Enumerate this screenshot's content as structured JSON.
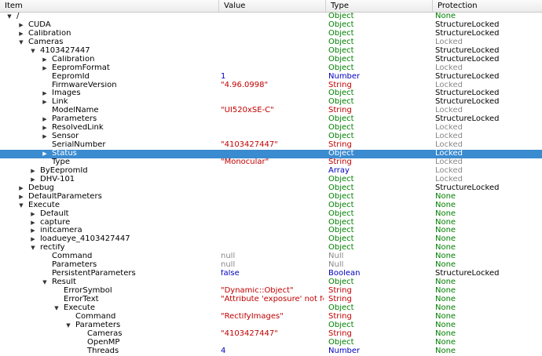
{
  "header": {
    "item": "Item",
    "value": "Value",
    "type": "Type",
    "protection": "Protection"
  },
  "rows": [
    {
      "label": "/",
      "depth": 0,
      "exp": "down",
      "value": "",
      "vcolor": "",
      "type": "Object",
      "tcolor": "green",
      "prot": "None",
      "pcolor": "green"
    },
    {
      "label": "CUDA",
      "depth": 1,
      "exp": "right",
      "value": "",
      "vcolor": "",
      "type": "Object",
      "tcolor": "green",
      "prot": "StructureLocked",
      "pcolor": "black"
    },
    {
      "label": "Calibration",
      "depth": 1,
      "exp": "right",
      "value": "",
      "vcolor": "",
      "type": "Object",
      "tcolor": "green",
      "prot": "StructureLocked",
      "pcolor": "black"
    },
    {
      "label": "Cameras",
      "depth": 1,
      "exp": "down",
      "value": "",
      "vcolor": "",
      "type": "Object",
      "tcolor": "green",
      "prot": "Locked",
      "pcolor": "gray"
    },
    {
      "label": "4103427447",
      "depth": 2,
      "exp": "down",
      "value": "",
      "vcolor": "",
      "type": "Object",
      "tcolor": "green",
      "prot": "StructureLocked",
      "pcolor": "black"
    },
    {
      "label": "Calibration",
      "depth": 3,
      "exp": "right",
      "value": "",
      "vcolor": "",
      "type": "Object",
      "tcolor": "green",
      "prot": "StructureLocked",
      "pcolor": "black"
    },
    {
      "label": "EepromFormat",
      "depth": 3,
      "exp": "right",
      "value": "",
      "vcolor": "",
      "type": "Object",
      "tcolor": "green",
      "prot": "Locked",
      "pcolor": "gray"
    },
    {
      "label": "EepromId",
      "depth": 3,
      "exp": "",
      "value": "1",
      "vcolor": "blue",
      "type": "Number",
      "tcolor": "blue",
      "prot": "StructureLocked",
      "pcolor": "black"
    },
    {
      "label": "FirmwareVersion",
      "depth": 3,
      "exp": "",
      "value": "\"4.96.0998\"",
      "vcolor": "red",
      "type": "String",
      "tcolor": "red",
      "prot": "Locked",
      "pcolor": "gray"
    },
    {
      "label": "Images",
      "depth": 3,
      "exp": "right",
      "value": "",
      "vcolor": "",
      "type": "Object",
      "tcolor": "green",
      "prot": "StructureLocked",
      "pcolor": "black"
    },
    {
      "label": "Link",
      "depth": 3,
      "exp": "right",
      "value": "",
      "vcolor": "",
      "type": "Object",
      "tcolor": "green",
      "prot": "StructureLocked",
      "pcolor": "black"
    },
    {
      "label": "ModelName",
      "depth": 3,
      "exp": "",
      "value": "\"UI520xSE-C\"",
      "vcolor": "red",
      "type": "String",
      "tcolor": "red",
      "prot": "Locked",
      "pcolor": "gray"
    },
    {
      "label": "Parameters",
      "depth": 3,
      "exp": "right",
      "value": "",
      "vcolor": "",
      "type": "Object",
      "tcolor": "green",
      "prot": "StructureLocked",
      "pcolor": "black"
    },
    {
      "label": "ResolvedLink",
      "depth": 3,
      "exp": "right",
      "value": "",
      "vcolor": "",
      "type": "Object",
      "tcolor": "green",
      "prot": "Locked",
      "pcolor": "gray"
    },
    {
      "label": "Sensor",
      "depth": 3,
      "exp": "right",
      "value": "",
      "vcolor": "",
      "type": "Object",
      "tcolor": "green",
      "prot": "Locked",
      "pcolor": "gray"
    },
    {
      "label": "SerialNumber",
      "depth": 3,
      "exp": "",
      "value": "\"4103427447\"",
      "vcolor": "red",
      "type": "String",
      "tcolor": "red",
      "prot": "Locked",
      "pcolor": "gray"
    },
    {
      "label": "Status",
      "depth": 3,
      "exp": "right",
      "value": "",
      "vcolor": "",
      "type": "Object",
      "tcolor": "green",
      "prot": "Locked",
      "pcolor": "gray",
      "selected": true
    },
    {
      "label": "Type",
      "depth": 3,
      "exp": "",
      "value": "\"Monocular\"",
      "vcolor": "red",
      "type": "String",
      "tcolor": "red",
      "prot": "Locked",
      "pcolor": "gray"
    },
    {
      "label": "ByEepromId",
      "depth": 2,
      "exp": "right",
      "value": "",
      "vcolor": "",
      "type": "Array",
      "tcolor": "blue",
      "prot": "Locked",
      "pcolor": "gray"
    },
    {
      "label": "DHV-101",
      "depth": 2,
      "exp": "right",
      "value": "",
      "vcolor": "",
      "type": "Object",
      "tcolor": "green",
      "prot": "Locked",
      "pcolor": "gray"
    },
    {
      "label": "Debug",
      "depth": 1,
      "exp": "right",
      "value": "",
      "vcolor": "",
      "type": "Object",
      "tcolor": "green",
      "prot": "StructureLocked",
      "pcolor": "black"
    },
    {
      "label": "DefaultParameters",
      "depth": 1,
      "exp": "right",
      "value": "",
      "vcolor": "",
      "type": "Object",
      "tcolor": "green",
      "prot": "None",
      "pcolor": "green"
    },
    {
      "label": "Execute",
      "depth": 1,
      "exp": "down",
      "value": "",
      "vcolor": "",
      "type": "Object",
      "tcolor": "green",
      "prot": "None",
      "pcolor": "green"
    },
    {
      "label": "Default",
      "depth": 2,
      "exp": "right",
      "value": "",
      "vcolor": "",
      "type": "Object",
      "tcolor": "green",
      "prot": "None",
      "pcolor": "green"
    },
    {
      "label": "capture",
      "depth": 2,
      "exp": "right",
      "value": "",
      "vcolor": "",
      "type": "Object",
      "tcolor": "green",
      "prot": "None",
      "pcolor": "green"
    },
    {
      "label": "initcamera",
      "depth": 2,
      "exp": "right",
      "value": "",
      "vcolor": "",
      "type": "Object",
      "tcolor": "green",
      "prot": "None",
      "pcolor": "green"
    },
    {
      "label": "loadueye_4103427447",
      "depth": 2,
      "exp": "right",
      "value": "",
      "vcolor": "",
      "type": "Object",
      "tcolor": "green",
      "prot": "None",
      "pcolor": "green"
    },
    {
      "label": "rectify",
      "depth": 2,
      "exp": "down",
      "value": "",
      "vcolor": "",
      "type": "Object",
      "tcolor": "green",
      "prot": "None",
      "pcolor": "green"
    },
    {
      "label": "Command",
      "depth": 3,
      "exp": "",
      "value": "null",
      "vcolor": "gray",
      "type": "Null",
      "tcolor": "gray",
      "prot": "None",
      "pcolor": "green"
    },
    {
      "label": "Parameters",
      "depth": 3,
      "exp": "",
      "value": "null",
      "vcolor": "gray",
      "type": "Null",
      "tcolor": "gray",
      "prot": "None",
      "pcolor": "green"
    },
    {
      "label": "PersistentParameters",
      "depth": 3,
      "exp": "",
      "value": "false",
      "vcolor": "blue",
      "type": "Boolean",
      "tcolor": "blue",
      "prot": "StructureLocked",
      "pcolor": "black"
    },
    {
      "label": "Result",
      "depth": 3,
      "exp": "down",
      "value": "",
      "vcolor": "",
      "type": "Object",
      "tcolor": "green",
      "prot": "None",
      "pcolor": "green"
    },
    {
      "label": "ErrorSymbol",
      "depth": 4,
      "exp": "",
      "value": "\"Dynamic::Object\"",
      "vcolor": "red",
      "type": "String",
      "tcolor": "red",
      "prot": "None",
      "pcolor": "green"
    },
    {
      "label": "ErrorText",
      "depth": 4,
      "exp": "",
      "value": "\"Attribute 'exposure' not fo...",
      "vcolor": "red",
      "type": "String",
      "tcolor": "red",
      "prot": "None",
      "pcolor": "green"
    },
    {
      "label": "Execute",
      "depth": 4,
      "exp": "down",
      "value": "",
      "vcolor": "",
      "type": "Object",
      "tcolor": "green",
      "prot": "None",
      "pcolor": "green"
    },
    {
      "label": "Command",
      "depth": 5,
      "exp": "",
      "value": "\"RectifyImages\"",
      "vcolor": "red",
      "type": "String",
      "tcolor": "red",
      "prot": "None",
      "pcolor": "green"
    },
    {
      "label": "Parameters",
      "depth": 5,
      "exp": "down",
      "value": "",
      "vcolor": "",
      "type": "Object",
      "tcolor": "green",
      "prot": "None",
      "pcolor": "green"
    },
    {
      "label": "Cameras",
      "depth": 6,
      "exp": "",
      "value": "\"4103427447\"",
      "vcolor": "red",
      "type": "String",
      "tcolor": "red",
      "prot": "None",
      "pcolor": "green"
    },
    {
      "label": "OpenMP",
      "depth": 6,
      "exp": "",
      "value": "",
      "vcolor": "",
      "type": "Object",
      "tcolor": "green",
      "prot": "None",
      "pcolor": "green"
    },
    {
      "label": "Threads",
      "depth": 6,
      "exp": "",
      "value": "4",
      "vcolor": "blue",
      "type": "Number",
      "tcolor": "blue",
      "prot": "None",
      "pcolor": "green"
    }
  ]
}
